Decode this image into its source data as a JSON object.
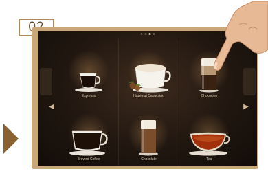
{
  "step_badge": "02",
  "drinks": [
    {
      "label": "Espresso",
      "icon": "espresso-cup-icon"
    },
    {
      "label": "Hazelnut Capuccino",
      "icon": "cappuccino-cup-icon"
    },
    {
      "label": "Chococino",
      "icon": "chococino-glass-icon"
    },
    {
      "label": "Brewed Coffee",
      "icon": "coffee-cup-icon"
    },
    {
      "label": "Chocolate",
      "icon": "chocolate-glass-icon"
    },
    {
      "label": "Tea",
      "icon": "tea-cup-icon"
    }
  ],
  "pager": {
    "pages": 4,
    "current": 3
  },
  "colors": {
    "badge_border": "#b08a5a",
    "frame": "#c9a777",
    "arrow": "#8a6232",
    "screen_bg": "#211710"
  }
}
